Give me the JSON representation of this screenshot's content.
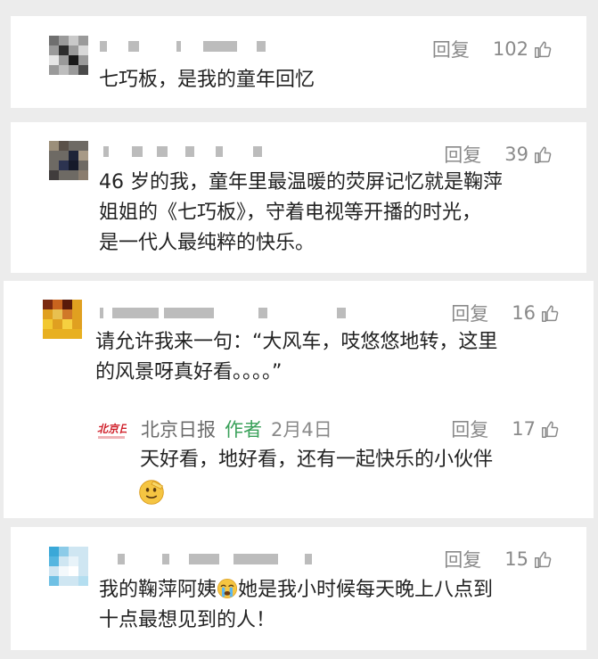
{
  "comments": [
    {
      "reply_label": "回复",
      "likes": "102",
      "lines": [
        "七巧板，是我的童年回忆"
      ]
    },
    {
      "reply_label": "回复",
      "likes": "39",
      "lines": [
        "46 岁的我，童年里最温暖的荧屏记忆就是鞠萍",
        "姐姐的《七巧板》，守着电视等开播的时光，",
        "是一代人最纯粹的快乐。"
      ]
    },
    {
      "reply_label": "回复",
      "likes": "16",
      "lines": [
        "请允许我来一句：“大风车，吱悠悠地转，这里",
        "的风景呀真好看。。。。”"
      ],
      "author_reply": {
        "name": "北京日报",
        "tag": "作者",
        "date": "2月4日",
        "reply_label": "回复",
        "likes": "17",
        "text": "天好看，地好看，还有一起快乐的小伙伴"
      }
    },
    {
      "reply_label": "回复",
      "likes": "15",
      "line1_before": "我的鞠萍阿姨",
      "line1_after": "她是我小时候每天晚上八点到",
      "line2": "十点最想见到的人！"
    }
  ],
  "icons": {
    "thumb": "thumbs-up-icon",
    "crying": "crying-face-emoji",
    "saluting": "saluting-face-emoji",
    "logo": "beijing-daily-logo"
  },
  "colors": {
    "background": "#ececec",
    "card": "#ffffff",
    "meta": "#8a8a8a",
    "author_tag": "#3aa15a",
    "text": "#222222",
    "logo_red": "#d0202a"
  }
}
